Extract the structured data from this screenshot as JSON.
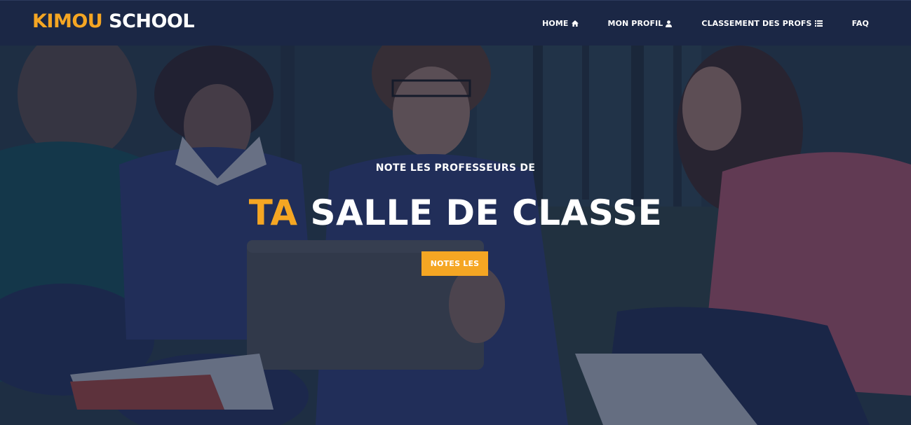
{
  "brand": {
    "part1": "KIMOU",
    "part2": " SCHOOL"
  },
  "nav": {
    "items": [
      {
        "label": "HOME",
        "icon": "home-icon"
      },
      {
        "label": "MON PROFIL",
        "icon": "user-icon"
      },
      {
        "label": "CLASSEMENT DES PROFS",
        "icon": "list-icon"
      },
      {
        "label": "FAQ",
        "icon": ""
      }
    ]
  },
  "hero": {
    "subtitle": "NOTE LES PROFESSEURS DE",
    "title_accent": "TA",
    "title_rest": " SALLE DE CLASSE",
    "cta_label": "NOTES LES"
  },
  "colors": {
    "accent": "#f5a623",
    "navbar": "#1b2745"
  }
}
